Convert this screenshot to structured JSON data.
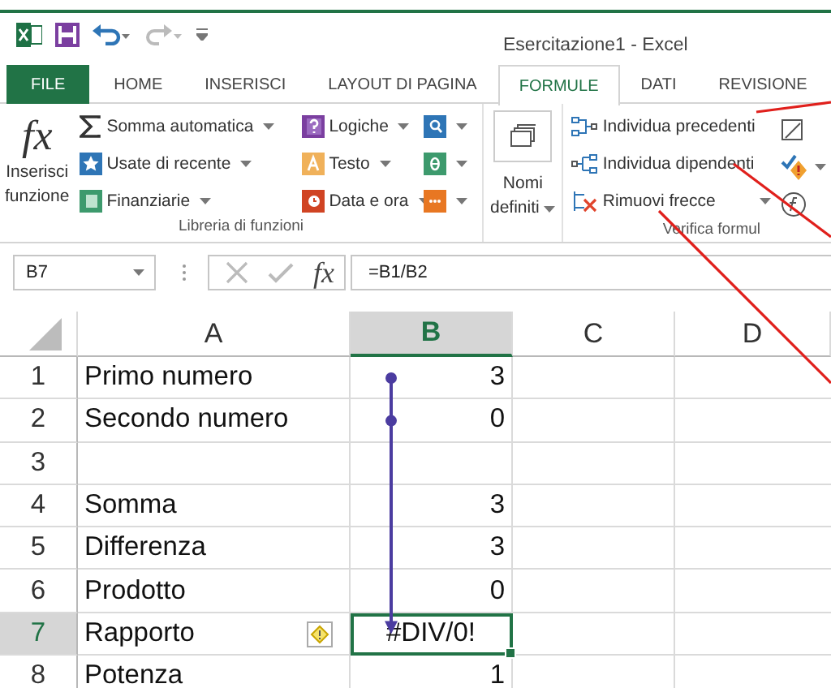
{
  "window": {
    "title": "Esercitazione1 - Excel"
  },
  "tabs": [
    {
      "label": "FILE",
      "kind": "file",
      "selected": false
    },
    {
      "label": "HOME",
      "kind": "tab",
      "selected": false
    },
    {
      "label": "INSERISCI",
      "kind": "tab",
      "selected": false
    },
    {
      "label": "LAYOUT DI PAGINA",
      "kind": "tab",
      "selected": false
    },
    {
      "label": "FORMULE",
      "kind": "tab",
      "selected": true
    },
    {
      "label": "DATI",
      "kind": "tab",
      "selected": false
    },
    {
      "label": "REVISIONE",
      "kind": "tab",
      "selected": false
    }
  ],
  "ribbon": {
    "insert_function": {
      "icon": "fx",
      "label_lines": [
        "Inserisci",
        "funzione"
      ]
    },
    "library_col1": [
      {
        "label": "Somma automatica"
      },
      {
        "label": "Usate di recente"
      },
      {
        "label": "Finanziarie"
      }
    ],
    "library_col2": [
      {
        "label": "Logiche"
      },
      {
        "label": "Testo"
      },
      {
        "label": "Data e ora"
      }
    ],
    "library_label": "Libreria di funzioni",
    "defined_names": {
      "label_lines": [
        "Nomi",
        "definiti"
      ]
    },
    "audit_items": [
      {
        "label": "Individua precedenti"
      },
      {
        "label": "Individua dipendenti"
      },
      {
        "label": "Rimuovi frecce"
      }
    ],
    "audit_label": "Verifica formul"
  },
  "formula_bar": {
    "name_box": "B7",
    "fx": "fx",
    "formula": "=B1/B2"
  },
  "sheet": {
    "columns": [
      {
        "label": "A",
        "selected": false
      },
      {
        "label": "B",
        "selected": true
      },
      {
        "label": "C",
        "selected": false
      },
      {
        "label": "D",
        "selected": false
      }
    ],
    "rows": [
      {
        "number": "1",
        "a": "Primo numero",
        "b": "3",
        "selected": false,
        "warning": false,
        "trace_source": true,
        "trace_target": false
      },
      {
        "number": "2",
        "a": "Secondo numero",
        "b": "0",
        "selected": false,
        "warning": false,
        "trace_source": true,
        "trace_target": false
      },
      {
        "number": "3",
        "a": "",
        "b": "",
        "selected": false,
        "warning": false,
        "trace_source": false,
        "trace_target": false
      },
      {
        "number": "4",
        "a": "Somma",
        "b": "3",
        "selected": false,
        "warning": false,
        "trace_source": false,
        "trace_target": false
      },
      {
        "number": "5",
        "a": "Differenza",
        "b": "3",
        "selected": false,
        "warning": false,
        "trace_source": false,
        "trace_target": false
      },
      {
        "number": "6",
        "a": "Prodotto",
        "b": "0",
        "selected": false,
        "warning": false,
        "trace_source": false,
        "trace_target": false
      },
      {
        "number": "7",
        "a": "Rapporto",
        "b": "#DIV/0!",
        "selected": true,
        "warning": true,
        "trace_source": false,
        "trace_target": true
      },
      {
        "number": "8",
        "a": "Potenza",
        "b": "1",
        "selected": false,
        "warning": false,
        "trace_source": false,
        "trace_target": false
      }
    ]
  }
}
